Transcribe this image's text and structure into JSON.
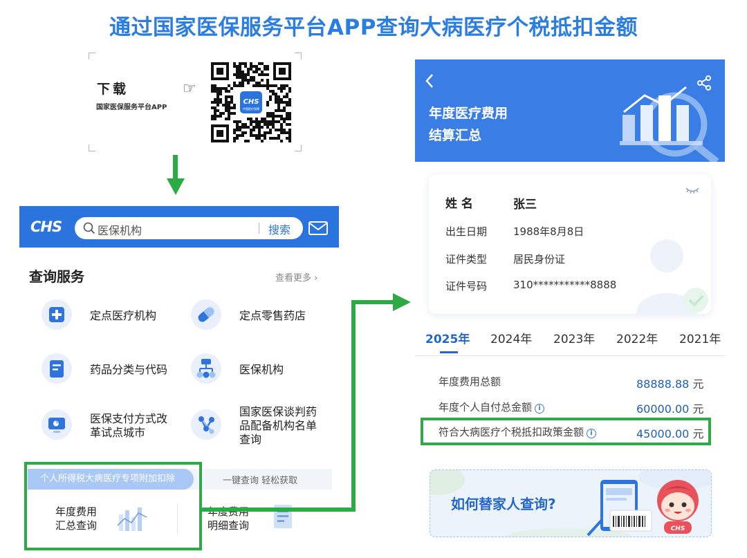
{
  "title": "通过国家医保服务平台APP查询大病医疗个税抵扣金额",
  "download": {
    "title": "下载",
    "subtitle": "国家医保服务平台APP"
  },
  "qr_badge": {
    "logo_text": "CHS",
    "caption": "中国医疗保障"
  },
  "app": {
    "logo": "CHS",
    "search_placeholder": "医保机构",
    "search_button": "搜索",
    "section_title": "查询服务",
    "more_link": "查看更多",
    "services": [
      {
        "label": "定点医疗机构",
        "icon": "hospital-plus-icon"
      },
      {
        "label": "定点零售药店",
        "icon": "pill-icon"
      },
      {
        "label": "药品分类与代码",
        "icon": "document-icon"
      },
      {
        "label": "医保机构",
        "icon": "org-chart-icon"
      },
      {
        "label": "医保支付方式改革试点城市",
        "line1": "医保支付方式改",
        "line2": "革试点城市",
        "icon": "monitor-icon"
      },
      {
        "label": "国家医保谈判药品配备机构名单查询",
        "line1": "国家医保谈判药",
        "line2": "品配备机构名单",
        "line3": "查询",
        "icon": "network-icon"
      }
    ],
    "tab_active": "个人所得税大病医疗专项附加扣除",
    "tab_inactive": "一键查询 轻松获取",
    "card_summary": {
      "line1": "年度费用",
      "line2": "汇总查询"
    },
    "card_detail": {
      "line1": "年度费用",
      "line2": "明细查询"
    }
  },
  "result": {
    "header_title_line1": "年度医疗费用",
    "header_title_line2": "结算汇总",
    "fields": [
      {
        "label": "姓 名",
        "value": "张三"
      },
      {
        "label": "出生日期",
        "value": "1988年8月8日"
      },
      {
        "label": "证件类型",
        "value": "居民身份证"
      },
      {
        "label": "证件号码",
        "value": "310***********8888"
      }
    ],
    "years": [
      "2025年",
      "2024年",
      "2023年",
      "2022年",
      "2021年"
    ],
    "active_year": "2025年",
    "fees": [
      {
        "label": "年度费用总额",
        "value": "88888.88",
        "unit": "元",
        "info": false
      },
      {
        "label": "年度个人自付总金额",
        "value": "60000.00",
        "unit": "元",
        "info": true
      },
      {
        "label": "符合大病医疗个税抵扣政策金额",
        "value": "45000.00",
        "unit": "元",
        "info": true
      }
    ],
    "info_glyph": "i",
    "banner_text": "如何替家人查询?",
    "banner_mascot_logo": "CHS"
  },
  "colors": {
    "title_blue": "#2a7de1",
    "app_blue": "#2b74de",
    "highlight_green": "#2daa45",
    "value_blue": "#1f5fb5"
  }
}
